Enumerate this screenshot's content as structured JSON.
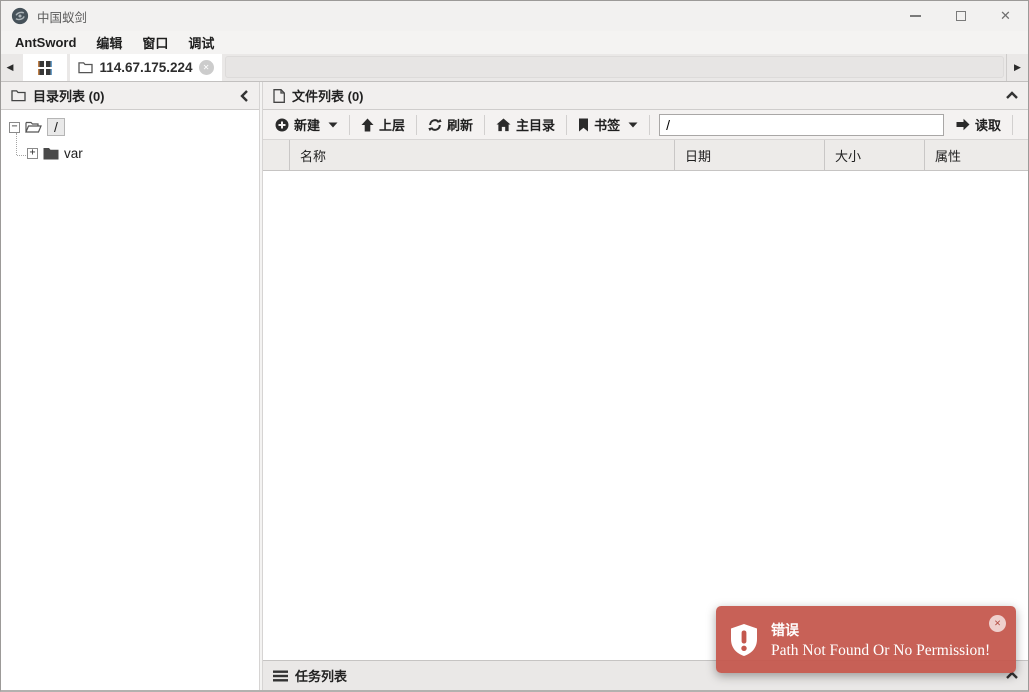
{
  "titlebar": {
    "app_title": "中国蚁剑"
  },
  "menubar": {
    "items": [
      "AntSword",
      "编辑",
      "窗口",
      "调试"
    ]
  },
  "tabbar": {
    "connection_tab_label": "114.67.175.224"
  },
  "directory_panel": {
    "title": "目录列表 (0)",
    "tree": [
      {
        "label": "/",
        "state": "expanded",
        "selected": true
      },
      {
        "label": "var",
        "state": "collapsed",
        "selected": false
      }
    ]
  },
  "file_panel": {
    "title": "文件列表 (0)",
    "toolbar": {
      "new_label": "新建",
      "up_label": "上层",
      "refresh_label": "刷新",
      "home_label": "主目录",
      "bookmark_label": "书签",
      "path_value": "/",
      "read_label": "读取"
    },
    "columns": [
      "名称",
      "日期",
      "大小",
      "属性"
    ]
  },
  "task_panel": {
    "title": "任务列表"
  },
  "toast": {
    "title": "错误",
    "message": "Path Not Found Or No Permission!"
  },
  "icons": {
    "minimize_glyph": "—",
    "close_glyph": "✕",
    "tab_prev_glyph": "◀",
    "tab_next_glyph": "▶",
    "tab_close_glyph": "✕",
    "toast_close_glyph": "✕",
    "tree_collapse_glyph": "−",
    "tree_expand_glyph": "+"
  },
  "colors": {
    "toast_bg": "#c5594e",
    "icon_dark": "#2b2b2b",
    "chrome_bg": "#f2f1f0"
  }
}
